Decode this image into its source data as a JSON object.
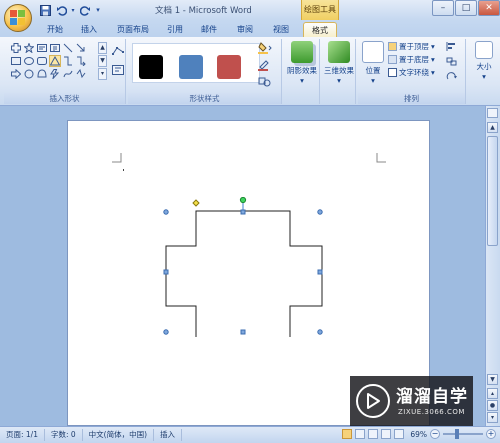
{
  "app": {
    "title": "文档 1 - Microsoft Word",
    "context_group_title": "绘图工具"
  },
  "qat": {
    "save_icon": "save-icon",
    "undo_icon": "undo-icon",
    "redo_icon": "redo-icon"
  },
  "tabs": [
    {
      "label": "开始"
    },
    {
      "label": "插入"
    },
    {
      "label": "页面布局"
    },
    {
      "label": "引用"
    },
    {
      "label": "邮件"
    },
    {
      "label": "审阅"
    },
    {
      "label": "视图"
    },
    {
      "label": "格式",
      "active": true
    }
  ],
  "ribbon": {
    "insert_shapes_label": "插入形状",
    "shape_styles_label": "形状样式",
    "shadow_effects_label": "阴影效果",
    "threed_effects_label": "三维效果",
    "arrange_label": "排列",
    "position_label": "位置",
    "bring_front_label": "置于顶层",
    "send_back_label": "置于底层",
    "text_wrap_label": "文字环绕",
    "size_label": "大小",
    "swatch_colors": [
      "#000000",
      "#4f81bd",
      "#c0504d"
    ]
  },
  "status": {
    "page": "页面: 1/1",
    "words": "字数: 0",
    "language": "中文(简体，中国)",
    "mode": "插入",
    "zoom": "69%"
  },
  "watermark": {
    "brand": "溜溜自学",
    "url": "ZIXUE.3066.COM"
  }
}
